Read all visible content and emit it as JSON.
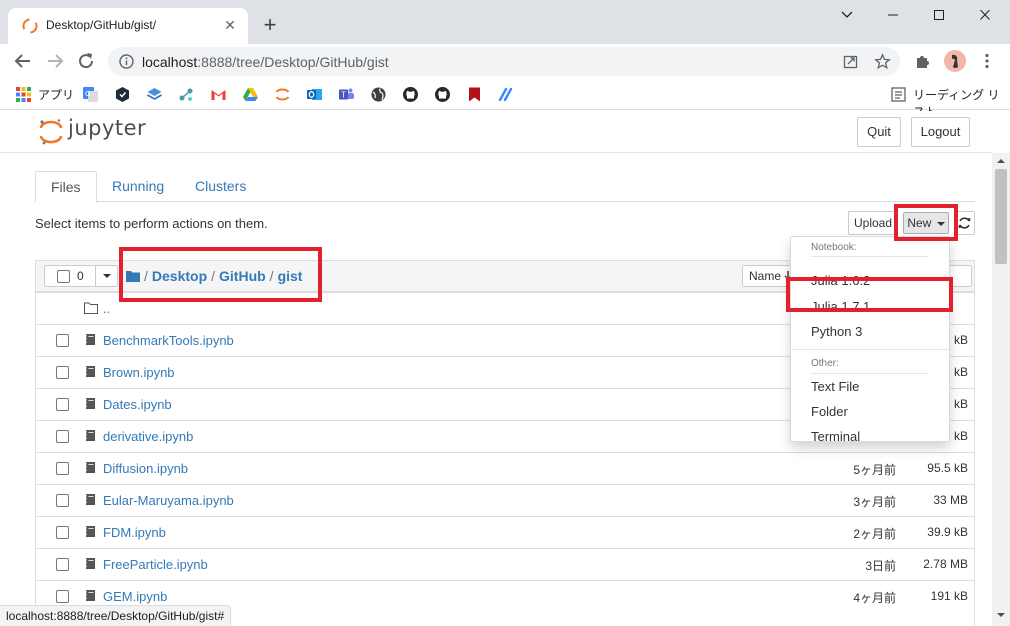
{
  "browser": {
    "tab_title": "Desktop/GitHub/gist/",
    "tab_close": "✕",
    "new_tab": "+",
    "url_host": "localhost",
    "url_rest": ":8888/tree/Desktop/GitHub/gist",
    "bookmarks": [
      {
        "icon": "apps-grid-icon",
        "label": "アプリ"
      },
      {
        "icon": "google-translate-icon"
      },
      {
        "icon": "hex-shield-icon"
      },
      {
        "icon": "stack-icon"
      },
      {
        "icon": "nodes-icon"
      },
      {
        "icon": "gmail-icon"
      },
      {
        "icon": "google-drive-icon"
      },
      {
        "icon": "jupyter-icon"
      },
      {
        "icon": "outlook-icon"
      },
      {
        "icon": "teams-icon"
      },
      {
        "icon": "globe-icon"
      },
      {
        "icon": "github-icon"
      },
      {
        "icon": "github-icon"
      },
      {
        "icon": "bookmark-red-icon"
      },
      {
        "icon": "slash-icon"
      }
    ],
    "reading_list": "リーディング リスト",
    "status_url": "localhost:8888/tree/Desktop/GitHub/gist#"
  },
  "jupyter": {
    "logo_text": "jupyter",
    "quit": "Quit",
    "logout": "Logout",
    "tabs": [
      "Files",
      "Running",
      "Clusters"
    ],
    "instructions": "Select items to perform actions on them.",
    "upload": "Upload",
    "new": "New",
    "selected_count": "0",
    "breadcrumb": [
      "Desktop",
      "GitHub",
      "gist"
    ],
    "sort_name": "Name",
    "sort_size": "e",
    "parent_dir": "..",
    "files": [
      {
        "name": "BenchmarkTools.ipynb",
        "modified": "",
        "size": "kB"
      },
      {
        "name": "Brown.ipynb",
        "modified": "",
        "size": "kB"
      },
      {
        "name": "Dates.ipynb",
        "modified": "",
        "size": "kB"
      },
      {
        "name": "derivative.ipynb",
        "modified": "",
        "size": "kB"
      },
      {
        "name": "Diffusion.ipynb",
        "modified": "5ヶ月前",
        "size": "95.5 kB"
      },
      {
        "name": "Eular-Maruyama.ipynb",
        "modified": "3ヶ月前",
        "size": "33 MB"
      },
      {
        "name": "FDM.ipynb",
        "modified": "2ヶ月前",
        "size": "39.9 kB"
      },
      {
        "name": "FreeParticle.ipynb",
        "modified": "3日前",
        "size": "2.78 MB"
      },
      {
        "name": "GEM.ipynb",
        "modified": "4ヶ月前",
        "size": "191 kB"
      }
    ],
    "dropdown": {
      "notebook_header": "Notebook:",
      "notebook_items": [
        "Julia 1.6.2",
        "Julia 1.7.1",
        "Python 3"
      ],
      "other_header": "Other:",
      "other_items": [
        "Text File",
        "Folder",
        "Terminal"
      ]
    }
  },
  "colors": {
    "link": "#337ab7",
    "highlight": "#e3202e",
    "jupyter_orange": "#f37726"
  }
}
